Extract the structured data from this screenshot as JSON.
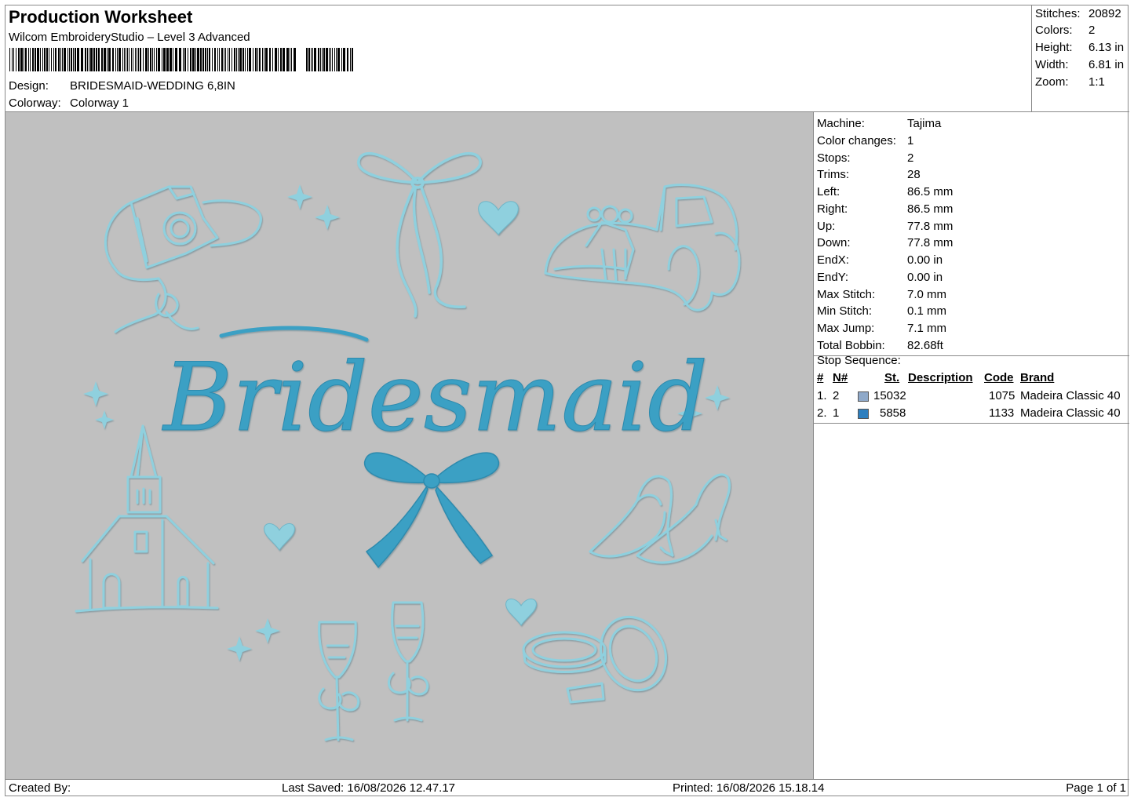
{
  "header": {
    "title": "Production Worksheet",
    "app": "Wilcom EmbroideryStudio – Level 3 Advanced",
    "design_label": "Design:",
    "design_value": "BRIDESMAID-WEDDING 6,8IN",
    "colorway_label": "Colorway:",
    "colorway_value": "Colorway 1"
  },
  "stats": [
    {
      "label": "Stitches:",
      "value": "20892"
    },
    {
      "label": "Colors:",
      "value": "2"
    },
    {
      "label": "Height:",
      "value": "6.13 in"
    },
    {
      "label": "Width:",
      "value": "6.81 in"
    },
    {
      "label": "Zoom:",
      "value": "1:1"
    }
  ],
  "info": [
    {
      "label": "Machine:",
      "value": "Tajima"
    },
    {
      "label": "Color changes:",
      "value": "1"
    },
    {
      "label": "Stops:",
      "value": "2"
    },
    {
      "label": "Trims:",
      "value": "28"
    },
    {
      "label": "Left:",
      "value": "86.5 mm"
    },
    {
      "label": "Right:",
      "value": "86.5 mm"
    },
    {
      "label": "Up:",
      "value": "77.8 mm"
    },
    {
      "label": "Down:",
      "value": "77.8 mm"
    },
    {
      "label": "EndX:",
      "value": "0.00 in"
    },
    {
      "label": "EndY:",
      "value": "0.00 in"
    },
    {
      "label": "Max Stitch:",
      "value": "7.0 mm"
    },
    {
      "label": "Min Stitch:",
      "value": "0.1 mm"
    },
    {
      "label": "Max Jump:",
      "value": "7.1 mm"
    },
    {
      "label": "Total Bobbin:",
      "value": "82.68ft"
    }
  ],
  "stop_sequence": {
    "label": "Stop Sequence:",
    "headers": {
      "num": "#",
      "n": "N#",
      "st": "St.",
      "desc": "Description",
      "code": "Code",
      "brand": "Brand"
    },
    "rows": [
      {
        "num": "1.",
        "n": "2",
        "color": "#8fa9c9",
        "st": "15032",
        "desc": "",
        "code": "1075",
        "brand": "Madeira Classic 40"
      },
      {
        "num": "2.",
        "n": "1",
        "color": "#2e7fbf",
        "st": "5858",
        "desc": "",
        "code": "1133",
        "brand": "Madeira Classic 40"
      }
    ]
  },
  "design": {
    "word": "Bridesmaid",
    "thread_light": "#8fd0de",
    "thread_dark": "#3aa0c4",
    "background": "#c0c0c0"
  },
  "footer": {
    "created_by": "Created By:",
    "last_saved": "Last Saved: 16/08/2026 12.47.17",
    "printed": "Printed: 16/08/2026 15.18.14",
    "page": "Page 1 of 1"
  }
}
